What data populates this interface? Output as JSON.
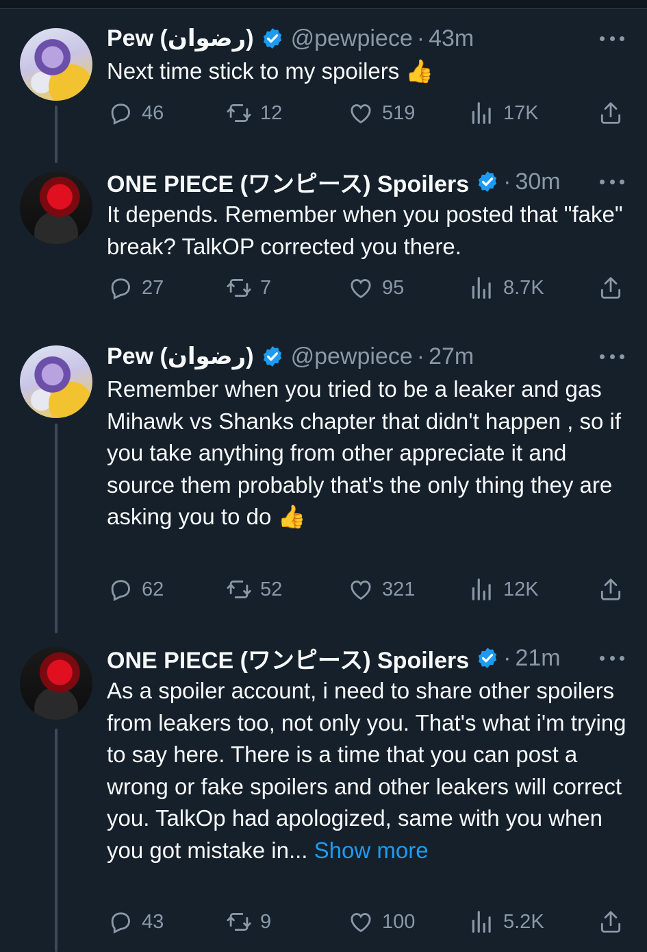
{
  "tweets": [
    {
      "avatar": "pew-avatar",
      "name": "Pew (رضوان)",
      "handle": "@pewpiece",
      "separator": "·",
      "time": "43m",
      "text": "Next time stick to my spoilers 👍",
      "show_more": "",
      "replies": "46",
      "retweets": "12",
      "likes": "519",
      "views": "17K"
    },
    {
      "avatar": "onepiece-avatar",
      "name": "ONE PIECE (ワンピース) Spoilers",
      "handle": "",
      "separator": "·",
      "time": "30m",
      "text": "It depends. Remember when you posted that \"fake\" break? TalkOP corrected you there.",
      "show_more": "",
      "replies": "27",
      "retweets": "7",
      "likes": "95",
      "views": "8.7K"
    },
    {
      "avatar": "pew-avatar",
      "name": "Pew (رضوان)",
      "handle": "@pewpiece",
      "separator": "·",
      "time": "27m",
      "text": "Remember when you tried to be a leaker and gas Mihawk vs Shanks chapter that didn't happen , so if you take anything from other appreciate it and source them probably that's the only thing they are asking you to do 👍",
      "show_more": "",
      "replies": "62",
      "retweets": "52",
      "likes": "321",
      "views": "12K"
    },
    {
      "avatar": "onepiece-avatar",
      "name": "ONE PIECE (ワンピース) Spoilers",
      "handle": "",
      "separator": "·",
      "time": "21m",
      "text": "As a spoiler account, i need to share other spoilers from leakers too, not only you. That's what i'm trying to say here. There is a time that you can post a wrong or fake spoilers and other leakers will correct you. TalkOp had apologized, same with you when you got mistake in...",
      "show_more": "Show more",
      "replies": "43",
      "retweets": "9",
      "likes": "100",
      "views": "5.2K"
    }
  ],
  "colors": {
    "background": "#15202b",
    "text": "#f7f9f9",
    "muted": "#8b98a5",
    "link": "#1d9bf0",
    "verified": "#1d9bf0"
  },
  "icons": [
    "reply-icon",
    "retweet-icon",
    "like-icon",
    "views-icon",
    "share-icon",
    "verified-badge-icon",
    "more-icon"
  ]
}
